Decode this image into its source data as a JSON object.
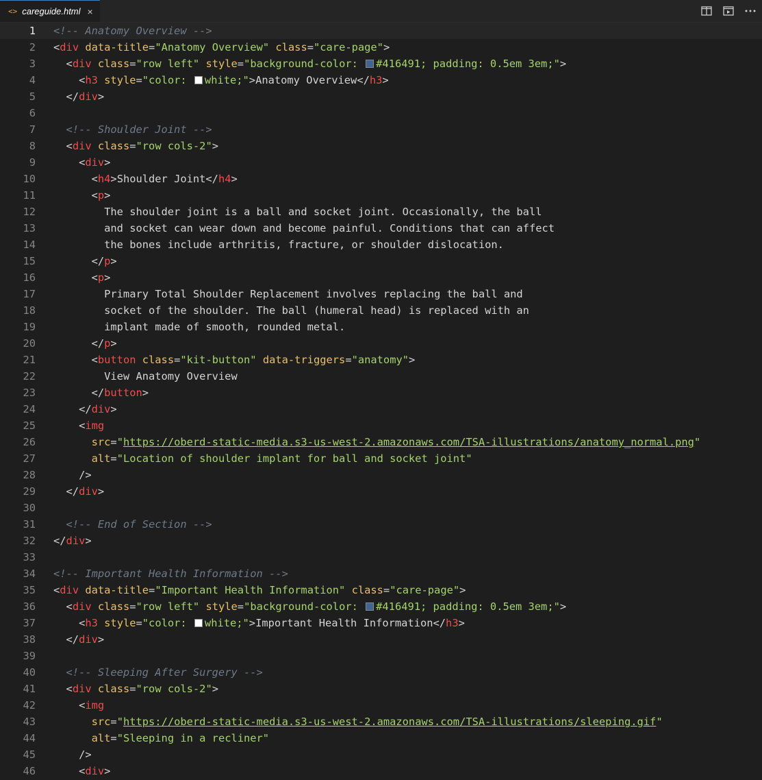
{
  "tab": {
    "title": "careguide.html",
    "icon": "code-file-icon",
    "close": "×"
  },
  "actions": [
    "split-editor-icon",
    "preview-icon",
    "more-actions-icon"
  ],
  "colors": {
    "swatch_blue": "#416491",
    "swatch_white": "#ffffff"
  },
  "current_line": 1,
  "lines": [
    [
      [
        "c",
        "<!-- Anatomy Overview -->"
      ]
    ],
    [
      [
        "p",
        "<"
      ],
      [
        "t",
        "div"
      ],
      [
        "a",
        " data-title"
      ],
      [
        "p",
        "="
      ],
      [
        "s",
        "\"Anatomy Overview\""
      ],
      [
        "a",
        " class"
      ],
      [
        "p",
        "="
      ],
      [
        "s",
        "\"care-page\""
      ],
      [
        "p",
        ">"
      ]
    ],
    [
      [
        "p",
        "  <"
      ],
      [
        "t",
        "div"
      ],
      [
        "a",
        " class"
      ],
      [
        "p",
        "="
      ],
      [
        "s",
        "\"row left\""
      ],
      [
        "a",
        " style"
      ],
      [
        "p",
        "="
      ],
      [
        "s",
        "\"background-color: "
      ],
      [
        "sw",
        "#416491"
      ],
      [
        "s",
        "#416491; padding: 0.5em 3em;\""
      ],
      [
        "p",
        ">"
      ]
    ],
    [
      [
        "p",
        "    <"
      ],
      [
        "t",
        "h3"
      ],
      [
        "a",
        " style"
      ],
      [
        "p",
        "="
      ],
      [
        "s",
        "\"color: "
      ],
      [
        "sw",
        "#ffffff"
      ],
      [
        "s",
        "white;\""
      ],
      [
        "p",
        ">Anatomy Overview</"
      ],
      [
        "t",
        "h3"
      ],
      [
        "p",
        ">"
      ]
    ],
    [
      [
        "p",
        "  </"
      ],
      [
        "t",
        "div"
      ],
      [
        "p",
        ">"
      ]
    ],
    [],
    [
      [
        "c",
        "  <!-- Shoulder Joint -->"
      ]
    ],
    [
      [
        "p",
        "  <"
      ],
      [
        "t",
        "div"
      ],
      [
        "a",
        " class"
      ],
      [
        "p",
        "="
      ],
      [
        "s",
        "\"row cols-2\""
      ],
      [
        "p",
        ">"
      ]
    ],
    [
      [
        "p",
        "    <"
      ],
      [
        "t",
        "div"
      ],
      [
        "p",
        ">"
      ]
    ],
    [
      [
        "p",
        "      <"
      ],
      [
        "t",
        "h4"
      ],
      [
        "p",
        ">Shoulder Joint</"
      ],
      [
        "t",
        "h4"
      ],
      [
        "p",
        ">"
      ]
    ],
    [
      [
        "p",
        "      <"
      ],
      [
        "t",
        "p"
      ],
      [
        "p",
        ">"
      ]
    ],
    [
      [
        "p",
        "        The shoulder joint is a ball and socket joint. Occasionally, the ball"
      ]
    ],
    [
      [
        "p",
        "        and socket can wear down and become painful. Conditions that can affect"
      ]
    ],
    [
      [
        "p",
        "        the bones include arthritis, fracture, or shoulder dislocation."
      ]
    ],
    [
      [
        "p",
        "      </"
      ],
      [
        "t",
        "p"
      ],
      [
        "p",
        ">"
      ]
    ],
    [
      [
        "p",
        "      <"
      ],
      [
        "t",
        "p"
      ],
      [
        "p",
        ">"
      ]
    ],
    [
      [
        "p",
        "        Primary Total Shoulder Replacement involves replacing the ball and"
      ]
    ],
    [
      [
        "p",
        "        socket of the shoulder. The ball (humeral head) is replaced with an"
      ]
    ],
    [
      [
        "p",
        "        implant made of smooth, rounded metal."
      ]
    ],
    [
      [
        "p",
        "      </"
      ],
      [
        "t",
        "p"
      ],
      [
        "p",
        ">"
      ]
    ],
    [
      [
        "p",
        "      <"
      ],
      [
        "t",
        "button"
      ],
      [
        "a",
        " class"
      ],
      [
        "p",
        "="
      ],
      [
        "s",
        "\"kit-button\""
      ],
      [
        "a",
        " data-triggers"
      ],
      [
        "p",
        "="
      ],
      [
        "s",
        "\"anatomy\""
      ],
      [
        "p",
        ">"
      ]
    ],
    [
      [
        "p",
        "        View Anatomy Overview"
      ]
    ],
    [
      [
        "p",
        "      </"
      ],
      [
        "t",
        "button"
      ],
      [
        "p",
        ">"
      ]
    ],
    [
      [
        "p",
        "    </"
      ],
      [
        "t",
        "div"
      ],
      [
        "p",
        ">"
      ]
    ],
    [
      [
        "p",
        "    <"
      ],
      [
        "t",
        "img"
      ]
    ],
    [
      [
        "a",
        "      src"
      ],
      [
        "p",
        "="
      ],
      [
        "s",
        "\""
      ],
      [
        "url",
        "https://oberd-static-media.s3-us-west-2.amazonaws.com/TSA-illustrations/anatomy_normal.png"
      ],
      [
        "s",
        "\""
      ]
    ],
    [
      [
        "a",
        "      alt"
      ],
      [
        "p",
        "="
      ],
      [
        "s",
        "\"Location of shoulder implant for ball and socket joint\""
      ]
    ],
    [
      [
        "p",
        "    />"
      ]
    ],
    [
      [
        "p",
        "  </"
      ],
      [
        "t",
        "div"
      ],
      [
        "p",
        ">"
      ]
    ],
    [],
    [
      [
        "c",
        "  <!-- End of Section -->"
      ]
    ],
    [
      [
        "p",
        "</"
      ],
      [
        "t",
        "div"
      ],
      [
        "p",
        ">"
      ]
    ],
    [],
    [
      [
        "c",
        "<!-- Important Health Information -->"
      ]
    ],
    [
      [
        "p",
        "<"
      ],
      [
        "t",
        "div"
      ],
      [
        "a",
        " data-title"
      ],
      [
        "p",
        "="
      ],
      [
        "s",
        "\"Important Health Information\""
      ],
      [
        "a",
        " class"
      ],
      [
        "p",
        "="
      ],
      [
        "s",
        "\"care-page\""
      ],
      [
        "p",
        ">"
      ]
    ],
    [
      [
        "p",
        "  <"
      ],
      [
        "t",
        "div"
      ],
      [
        "a",
        " class"
      ],
      [
        "p",
        "="
      ],
      [
        "s",
        "\"row left\""
      ],
      [
        "a",
        " style"
      ],
      [
        "p",
        "="
      ],
      [
        "s",
        "\"background-color: "
      ],
      [
        "sw",
        "#416491"
      ],
      [
        "s",
        "#416491; padding: 0.5em 3em;\""
      ],
      [
        "p",
        ">"
      ]
    ],
    [
      [
        "p",
        "    <"
      ],
      [
        "t",
        "h3"
      ],
      [
        "a",
        " style"
      ],
      [
        "p",
        "="
      ],
      [
        "s",
        "\"color: "
      ],
      [
        "sw",
        "#ffffff"
      ],
      [
        "s",
        "white;\""
      ],
      [
        "p",
        ">Important Health Information</"
      ],
      [
        "t",
        "h3"
      ],
      [
        "p",
        ">"
      ]
    ],
    [
      [
        "p",
        "  </"
      ],
      [
        "t",
        "div"
      ],
      [
        "p",
        ">"
      ]
    ],
    [],
    [
      [
        "c",
        "  <!-- Sleeping After Surgery -->"
      ]
    ],
    [
      [
        "p",
        "  <"
      ],
      [
        "t",
        "div"
      ],
      [
        "a",
        " class"
      ],
      [
        "p",
        "="
      ],
      [
        "s",
        "\"row cols-2\""
      ],
      [
        "p",
        ">"
      ]
    ],
    [
      [
        "p",
        "    <"
      ],
      [
        "t",
        "img"
      ]
    ],
    [
      [
        "a",
        "      src"
      ],
      [
        "p",
        "="
      ],
      [
        "s",
        "\""
      ],
      [
        "url",
        "https://oberd-static-media.s3-us-west-2.amazonaws.com/TSA-illustrations/sleeping.gif"
      ],
      [
        "s",
        "\""
      ]
    ],
    [
      [
        "a",
        "      alt"
      ],
      [
        "p",
        "="
      ],
      [
        "s",
        "\"Sleeping in a recliner\""
      ]
    ],
    [
      [
        "p",
        "    />"
      ]
    ],
    [
      [
        "p",
        "    <"
      ],
      [
        "t",
        "div"
      ],
      [
        "p",
        ">"
      ]
    ]
  ]
}
